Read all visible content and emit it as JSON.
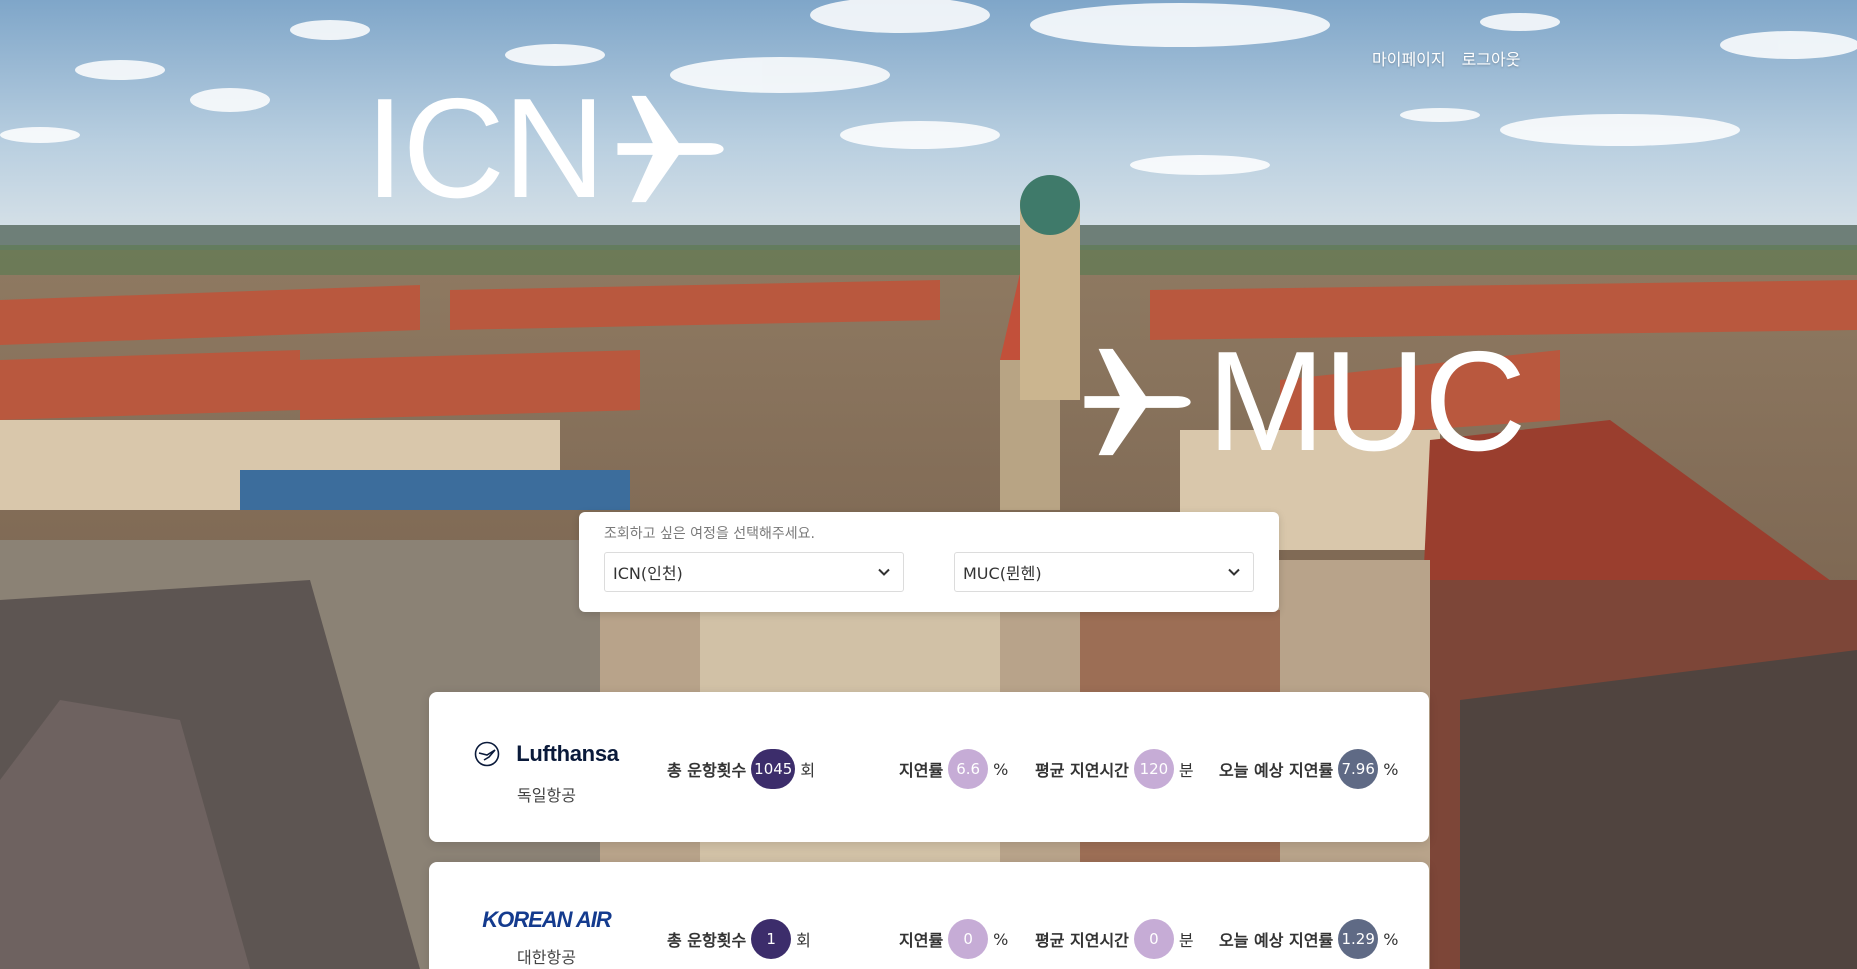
{
  "nav": {
    "mypage": "마이페이지",
    "logout": "로그아웃"
  },
  "route": {
    "from": "ICN",
    "to": "MUC"
  },
  "search": {
    "hint": "조회하고 싶은 여정을 선택해주세요.",
    "departure": "ICN(인천)",
    "arrival": "MUC(뮌헨)"
  },
  "airlines": [
    {
      "logo_text": "Lufthansa",
      "name": "독일항공",
      "total_flights_label": "총 운항횟수",
      "total_flights": "1045",
      "total_flights_unit": "회",
      "delay_rate_label": "지연률",
      "delay_rate": "6.6",
      "delay_rate_unit": "%",
      "avg_delay_label": "평균 지연시간",
      "avg_delay": "120",
      "avg_delay_unit": "분",
      "today_rate_label": "오늘 예상 지연률",
      "today_rate": "7.96",
      "today_rate_unit": "%"
    },
    {
      "logo_text": "KOREAN AIR",
      "name": "대한항공",
      "total_flights_label": "총 운항횟수",
      "total_flights": "1",
      "total_flights_unit": "회",
      "delay_rate_label": "지연률",
      "delay_rate": "0",
      "delay_rate_unit": "%",
      "avg_delay_label": "평균 지연시간",
      "avg_delay": "0",
      "avg_delay_unit": "분",
      "today_rate_label": "오늘 예상 지연률",
      "today_rate": "1.29",
      "today_rate_unit": "%"
    }
  ],
  "icons": {
    "plane": "airplane-icon",
    "chevron": "chevron-down-icon"
  },
  "colors": {
    "badge_dark": "#3c2d6b",
    "badge_light": "#c6acd6",
    "badge_slate": "#5f6a85"
  }
}
